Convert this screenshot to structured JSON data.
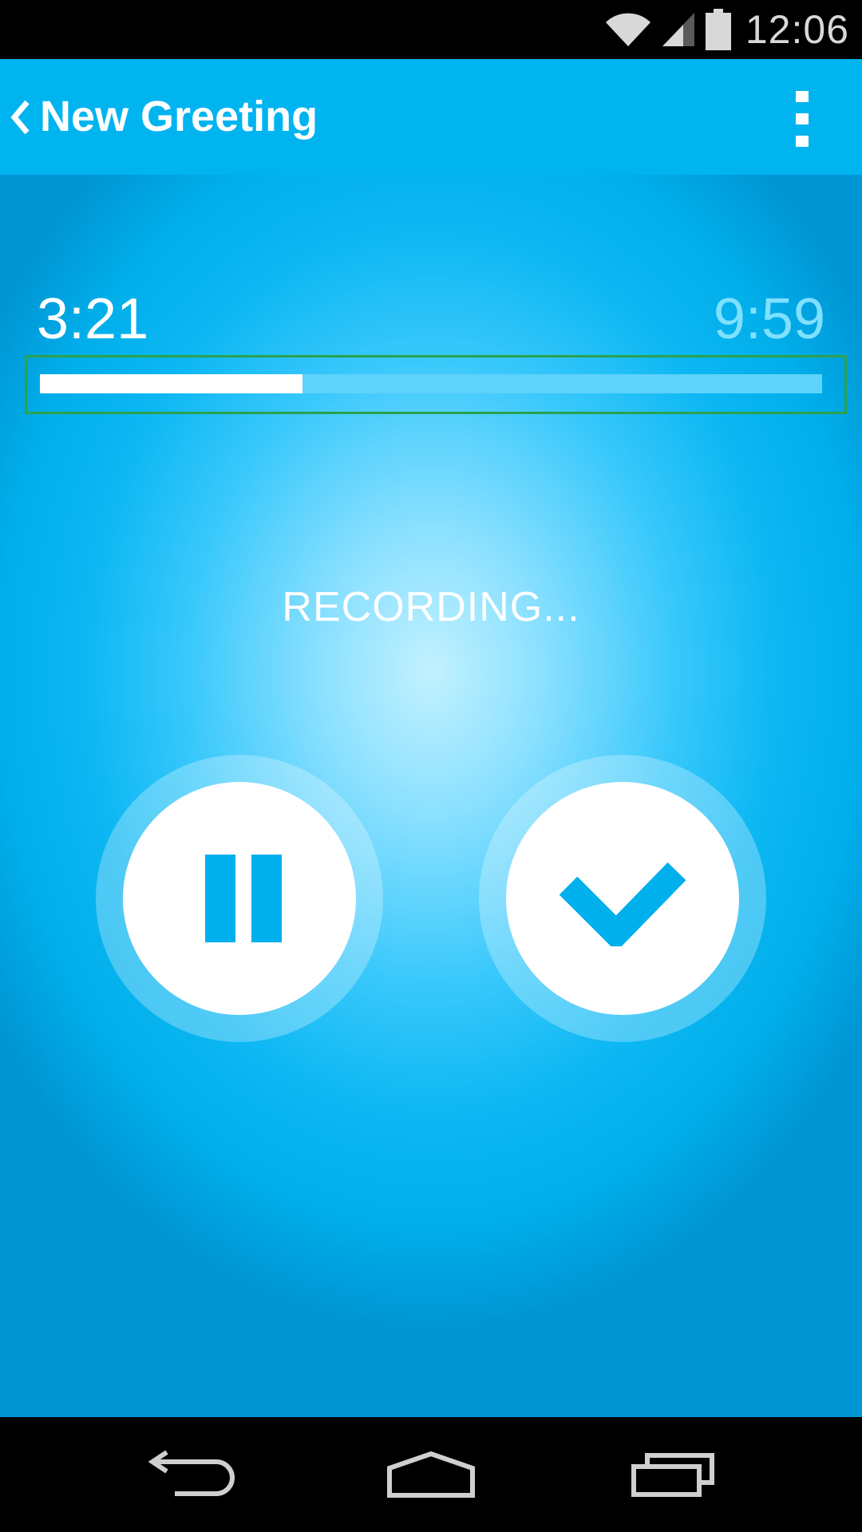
{
  "status_bar": {
    "time": "12:06",
    "icons": [
      "wifi-icon",
      "signal-icon",
      "battery-icon"
    ]
  },
  "action_bar": {
    "title": "New Greeting",
    "back_icon": "chevron-left-icon",
    "menu_icon": "overflow-menu-icon"
  },
  "recorder": {
    "elapsed": "3:21",
    "limit": "9:59",
    "progress_fraction": 0.336,
    "status": "RECORDING...",
    "pause_icon": "pause-icon",
    "done_icon": "check-icon"
  },
  "nav_bar": {
    "icons": [
      "back-icon",
      "home-icon",
      "recents-icon"
    ]
  },
  "colors": {
    "accent": "#00b4f0",
    "icon_blue": "#00b0ec",
    "progress_frame": "#2aa14d"
  }
}
